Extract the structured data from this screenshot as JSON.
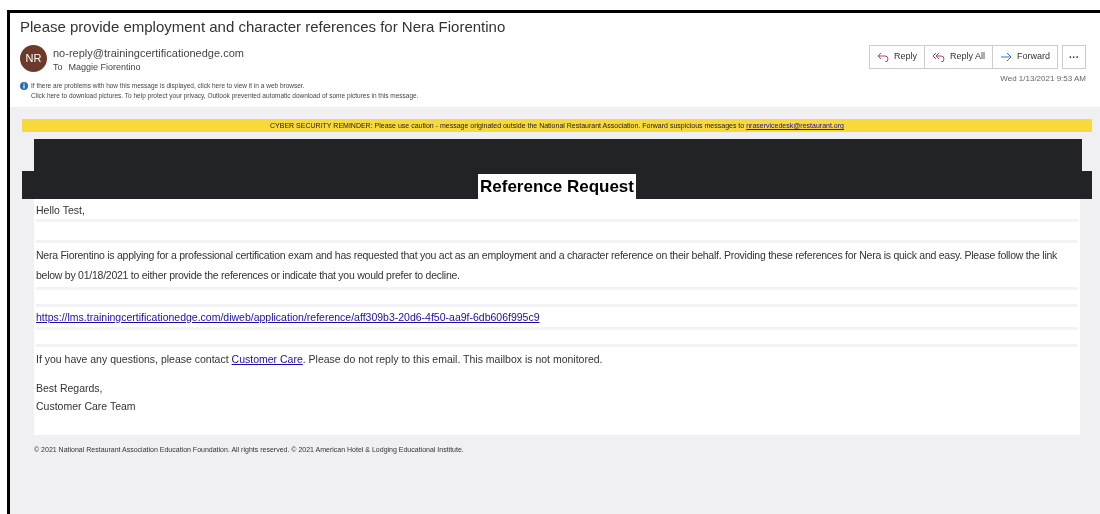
{
  "email": {
    "subject": "Please provide employment and character references for Nera Fiorentino",
    "avatar_initials": "NR",
    "sender": "no-reply@trainingcertificationedge.com",
    "to_label": "To",
    "recipient": "Maggie Fiorentino",
    "info_lines": [
      "If there are problems with how this message is displayed, click here to view it in a web browser.",
      "Click here to download pictures. To help protect your privacy, Outlook prevented automatic download of some pictures in this message."
    ],
    "actions": [
      {
        "kind": "reply",
        "label": "Reply"
      },
      {
        "kind": "reply_all",
        "label": "Reply All"
      },
      {
        "kind": "forward",
        "label": "Forward"
      },
      {
        "kind": "more",
        "label": "···"
      }
    ],
    "date": "Wed 1/13/2021 9:53 AM"
  },
  "banner": {
    "text": "CYBER SECURITY REMINDER: Please use caution - message originated outside the National Restaurant Association. Forward suspicious messages to",
    "link": "nraservicedesk@restaurant.org"
  },
  "body": {
    "heading": "Reference Request",
    "greeting": "Hello Test,",
    "paragraph": "Nera Fiorentino is applying for a professional certification exam and has requested that you act as an employment and a character reference on their behalf. Providing these references for Nera is quick and easy. Please follow the link below by 01/18/2021 to either provide the references or indicate that you would prefer to decline.",
    "url": "https://lms.trainingcertificationedge.com/diweb/application/reference/aff309b3-20d6-4f50-aa9f-6db606f995c9",
    "contact_before": "If you have any questions, please contact",
    "contact_link": "Customer Care",
    "contact_after": ". Please do not reply to this email. This mailbox is not monitored.",
    "closing": "Best Regards,",
    "signature": "Customer Care Team"
  },
  "footer": "© 2021 National Restaurant Association Education Foundation. All rights reserved. © 2021 American Hotel & Lodging Educational Institute."
}
